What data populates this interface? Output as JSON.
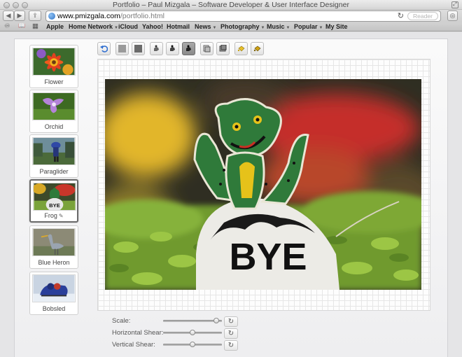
{
  "window": {
    "title": "Portfolio – Paul Mizgala – Software Developer & User Interface Designer"
  },
  "browser": {
    "url_domain": "www.pmizgala.com",
    "url_path": "/portfolio.html",
    "reader_label": "Reader",
    "back_icon": "◀",
    "forward_icon": "▶",
    "share_icon": "⇪",
    "reload_icon": "↻",
    "tabs_icon": "◎",
    "fullscreen_icon": "⤢"
  },
  "bookmarks": [
    {
      "label": "Apple",
      "menu": false
    },
    {
      "label": "Home Network",
      "menu": true
    },
    {
      "label": "iCloud",
      "menu": false
    },
    {
      "label": "Yahoo!",
      "menu": false
    },
    {
      "label": "Hotmail",
      "menu": false
    },
    {
      "label": "News",
      "menu": true
    },
    {
      "label": "Photography",
      "menu": true
    },
    {
      "label": "Music",
      "menu": true
    },
    {
      "label": "Popular",
      "menu": true
    },
    {
      "label": "My Site",
      "menu": false
    }
  ],
  "bookmark_icons": {
    "reading_list": "♾",
    "bookmarks": "📖",
    "top_sites": "▦",
    "menu_arrow": "▼"
  },
  "thumbnails": [
    {
      "label": "Flower",
      "selected": false
    },
    {
      "label": "Orchid",
      "selected": false
    },
    {
      "label": "Paraglider",
      "selected": false
    },
    {
      "label": "Frog",
      "selected": true,
      "edit_icon": "✎"
    },
    {
      "label": "Blue Heron",
      "selected": false
    },
    {
      "label": "Bobsled",
      "selected": false
    }
  ],
  "tools": [
    "undo-icon",
    "grayscale-light-icon",
    "grayscale-dark-icon",
    "stamp-light-icon",
    "stamp-medium-icon",
    "stamp-dark-icon",
    "layer-flip-icon",
    "layer-rotate-icon",
    "bucket-light-icon",
    "bucket-dark-icon"
  ],
  "photo": {
    "sign_text": "BYE"
  },
  "controls": [
    {
      "label": "Scale:",
      "value": 0.95,
      "reset_icon": "↻"
    },
    {
      "label": "Horizontal Shear:",
      "value": 0.5,
      "reset_icon": "↻"
    },
    {
      "label": "Vertical Shear:",
      "value": 0.5,
      "reset_icon": "↻"
    }
  ],
  "colors": {
    "selected_border": "#6a6a6a",
    "frog_green": "#2f7a3a",
    "frog_yellow": "#e6c21a"
  }
}
